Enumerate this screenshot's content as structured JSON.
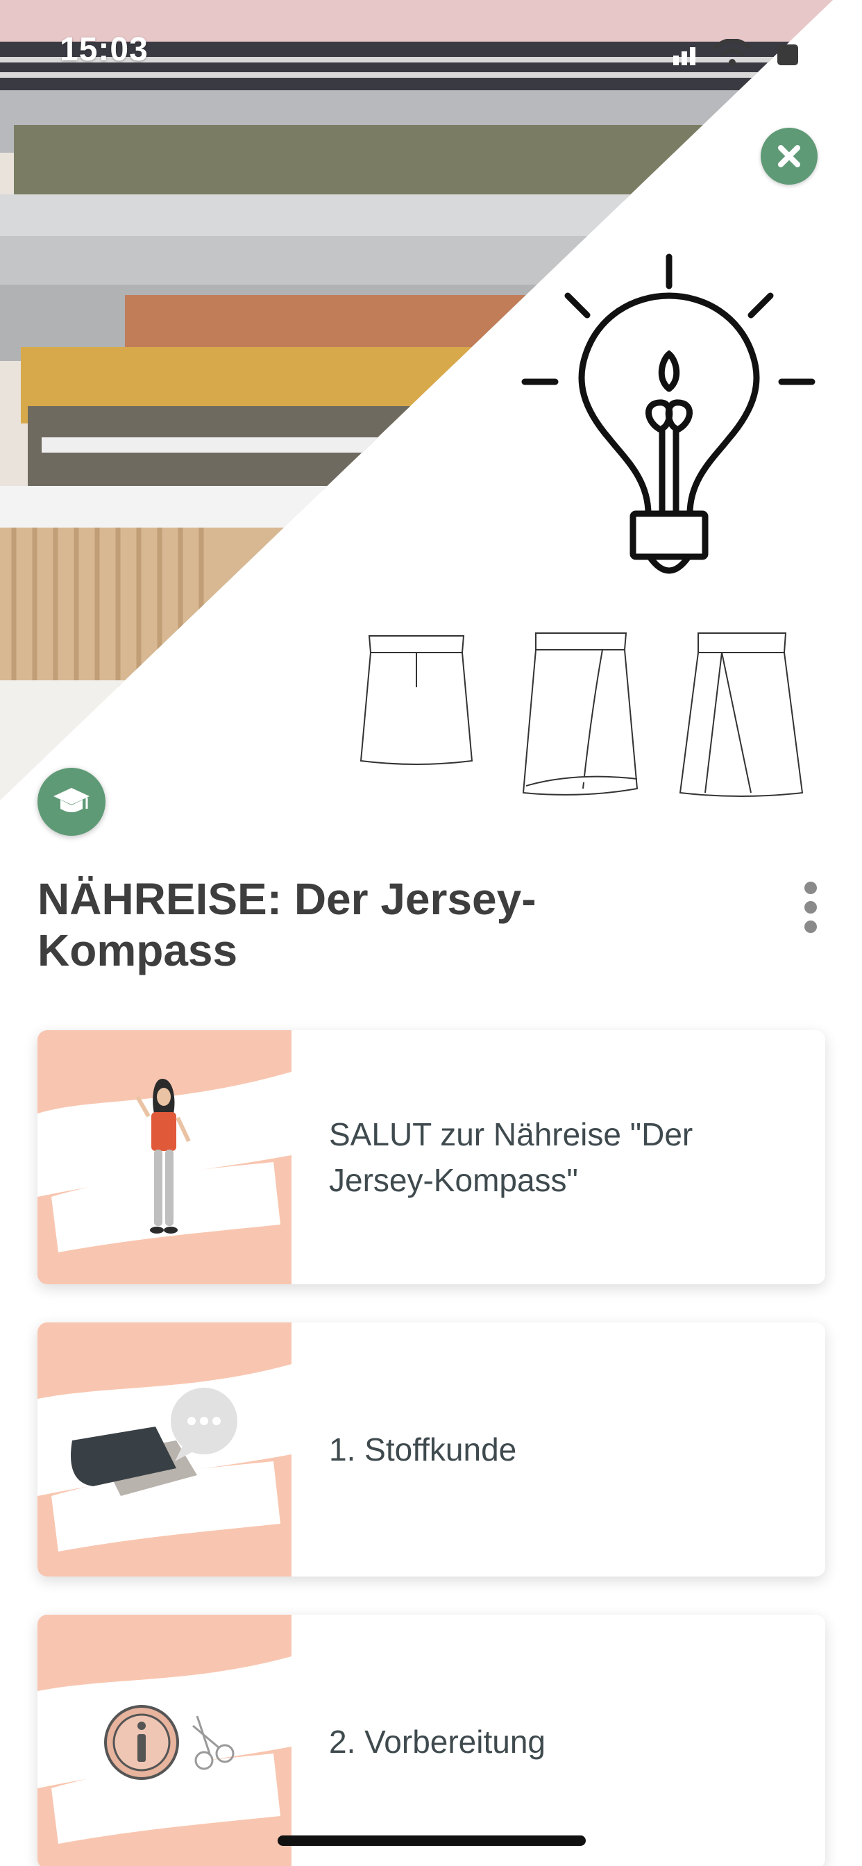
{
  "status_bar": {
    "time": "15:03"
  },
  "icons": {
    "close": "close-icon",
    "course": "graduation-cap-icon",
    "more": "more-vertical-icon",
    "bulb": "lightbulb-icon"
  },
  "colors": {
    "accent_green": "#5f9a76",
    "card_thumb_bg": "#f8c6b0",
    "title_text": "#3e3e3e",
    "card_text": "#3f4a4e"
  },
  "course": {
    "title": "NÄHREISE: Der Jersey-Kompass"
  },
  "lessons": [
    {
      "label": "SALUT zur Nähreise \"Der Jersey-Kompass\"",
      "thumb_icon": "woman-illustration-icon"
    },
    {
      "label": "1. Stoffkunde",
      "thumb_icon": "folded-fabric-icon"
    },
    {
      "label": "2. Vorbereitung",
      "thumb_icon": "info-scissors-icon"
    }
  ]
}
